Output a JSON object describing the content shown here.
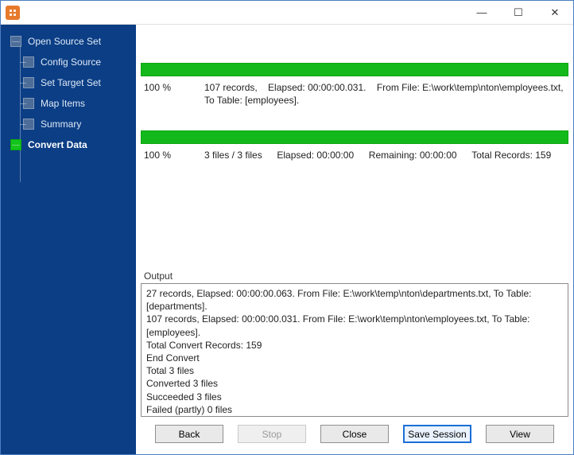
{
  "titlebar": {
    "minimize": "—",
    "maximize": "☐",
    "close": "✕"
  },
  "sidebar": {
    "items": [
      {
        "label": "Open Source Set",
        "level": "root",
        "active": false
      },
      {
        "label": "Config Source",
        "level": "child",
        "active": false
      },
      {
        "label": "Set Target Set",
        "level": "child",
        "active": false
      },
      {
        "label": "Map Items",
        "level": "child",
        "active": false
      },
      {
        "label": "Summary",
        "level": "child",
        "active": false
      },
      {
        "label": "Convert Data",
        "level": "root",
        "active": true
      }
    ]
  },
  "progress": {
    "fileProgress": {
      "percent": "100 %",
      "records": "107 records,",
      "elapsed": "Elapsed: 00:00:00.031.",
      "from": "From File: E:\\work\\temp\\nton\\employees.txt,",
      "to": "To Table: [employees]."
    },
    "overallProgress": {
      "percent": "100 %",
      "files": "3 files / 3 files",
      "elapsed": "Elapsed: 00:00:00",
      "remaining": "Remaining: 00:00:00",
      "total": "Total Records: 159"
    }
  },
  "output": {
    "label": "Output",
    "lines": [
      "27 records,    Elapsed: 00:00:00.063.    From File: E:\\work\\temp\\nton\\departments.txt,    To Table: [departments].",
      "107 records,    Elapsed: 00:00:00.031.    From File: E:\\work\\temp\\nton\\employees.txt,    To Table: [employees].",
      "Total Convert Records: 159",
      "End Convert",
      "Total 3 files",
      "Converted 3 files",
      "Succeeded 3 files",
      "Failed (partly) 0 files"
    ]
  },
  "buttons": {
    "back": "Back",
    "stop": "Stop",
    "close": "Close",
    "save": "Save Session",
    "view": "View"
  }
}
